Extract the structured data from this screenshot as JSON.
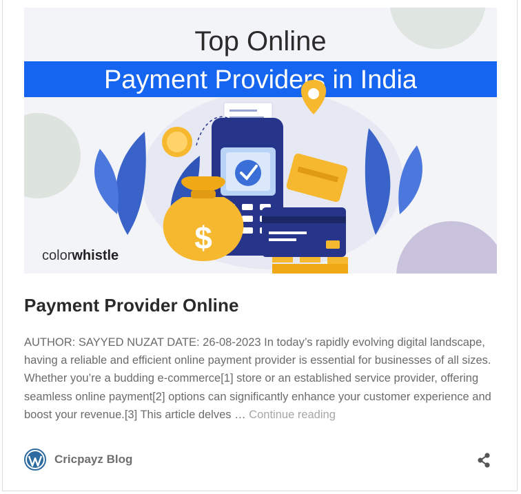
{
  "hero": {
    "title_line1": "Top Online",
    "title_line2": "Payment Providers in India",
    "brand_prefix": "color",
    "brand_suffix": "whistle",
    "currency_symbol": "$",
    "colors": {
      "banner_blue": "#1565f0",
      "terminal_navy": "#26358a",
      "coin_yellow": "#f6b82f",
      "leaf_blue": "#3a63c9",
      "background": "#f3f4f7"
    }
  },
  "post": {
    "title": "Payment Provider Online",
    "excerpt": "AUTHOR: SAYYED NUZAT DATE: 26-08-2023 In today’s rapidly evolving digital landscape, having a reliable and efficient online payment provider is essential for businesses of all sizes. Whether you’re a budding e-commerce[1] store or an established service provider, offering seamless online payment[2] options can significantly enhance your customer experience and boost your revenue.[3] This article delves … ",
    "continue_label": "Continue reading"
  },
  "footer": {
    "blog_name": "Cricpayz Blog",
    "logo_icon": "wordpress-icon",
    "share_icon": "share-icon"
  }
}
